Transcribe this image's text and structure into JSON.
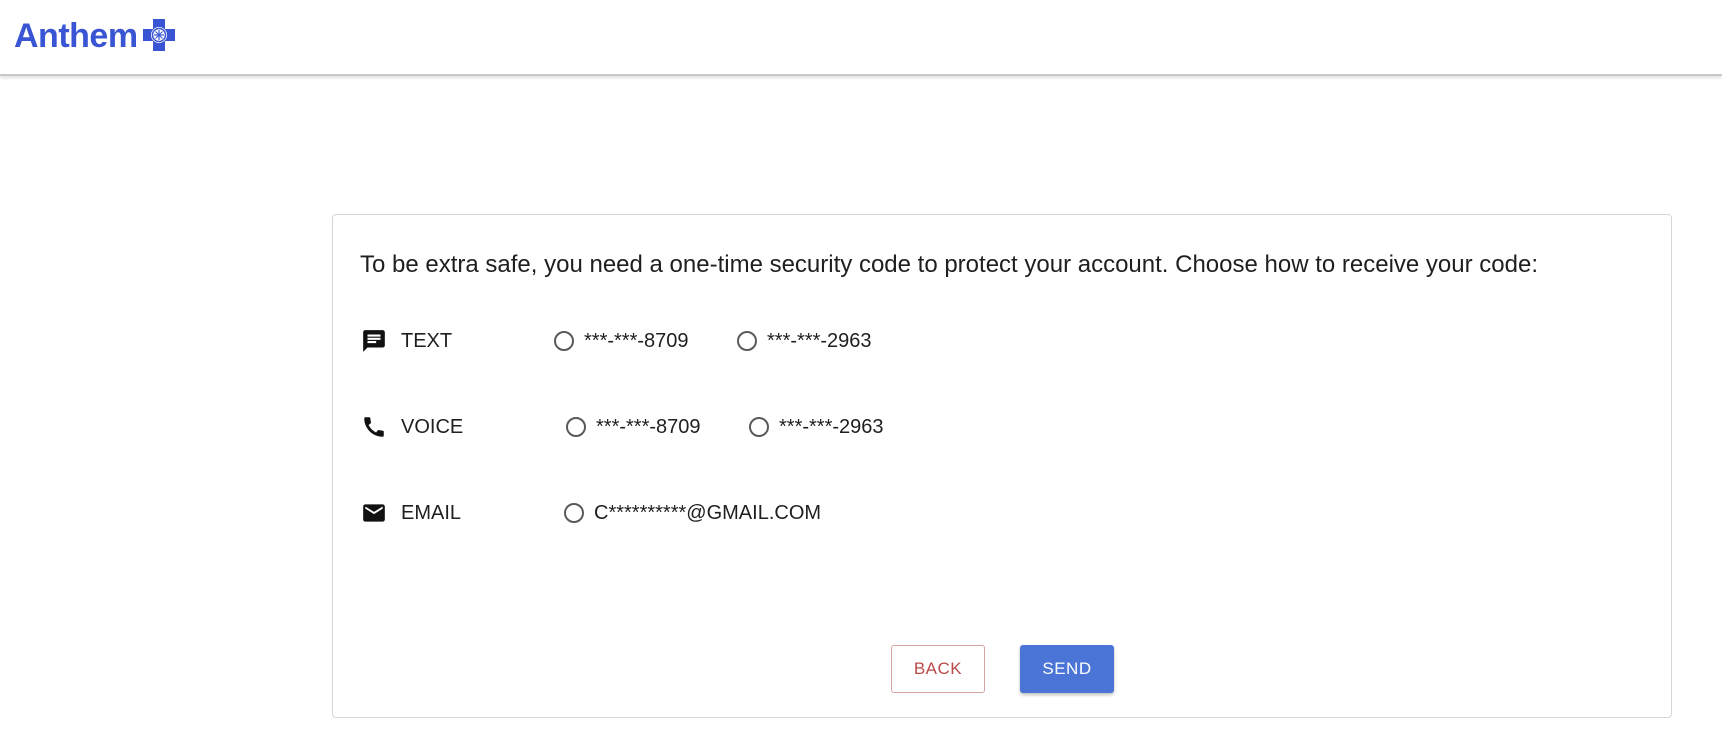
{
  "header": {
    "logo_text": "Anthem",
    "logo_mark": "blue-cross-shield-icon",
    "brand_color": "#3a55d4"
  },
  "card": {
    "prompt": "To be extra safe, you need a one-time security code to protect your account. Choose how to receive your code:",
    "methods": [
      {
        "label": "TEXT",
        "icon": "message-icon",
        "options": [
          {
            "label": "***-***-8709",
            "selected": false
          },
          {
            "label": "***-***-2963",
            "selected": false
          }
        ]
      },
      {
        "label": "VOICE",
        "icon": "phone-icon",
        "options": [
          {
            "label": "***-***-8709",
            "selected": false
          },
          {
            "label": "***-***-2963",
            "selected": false
          }
        ]
      },
      {
        "label": "EMAIL",
        "icon": "mail-icon",
        "options": [
          {
            "label": "C**********@GMAIL.COM",
            "selected": false
          }
        ]
      }
    ],
    "buttons": {
      "back_label": "BACK",
      "send_label": "SEND"
    }
  },
  "colors": {
    "send_button": "#4a74d6",
    "back_button_text": "#b84a4a"
  }
}
